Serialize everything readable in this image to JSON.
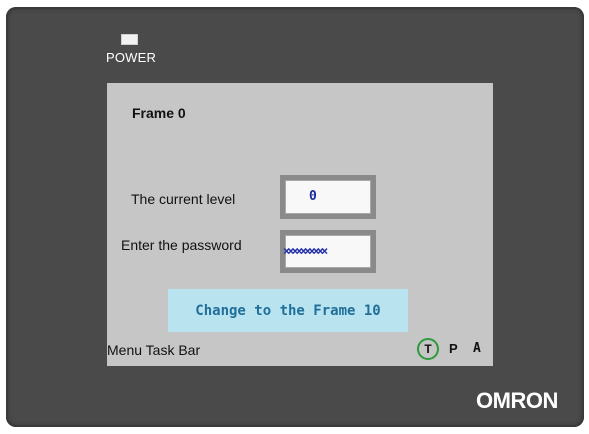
{
  "device": {
    "power_label": "POWER",
    "brand": "OMRON"
  },
  "screen": {
    "frame_title": "Frame 0",
    "current_level_label": "The current level",
    "current_level_value": "0",
    "password_label": "Enter the password",
    "password_value": "××××××××××",
    "change_button_label": "Change to the Frame 10",
    "taskbar_label": "Menu  Task Bar",
    "indicators": {
      "t": "T",
      "p": "P",
      "a": "A"
    }
  },
  "colors": {
    "bezel": "#4a4a4a",
    "screen_bg": "#c6c6c6",
    "button_bg": "#b9e3ef",
    "button_text": "#1f6f9a",
    "value_text": "#1a2a9a",
    "t_indicator_ring": "#2d9a3c"
  }
}
